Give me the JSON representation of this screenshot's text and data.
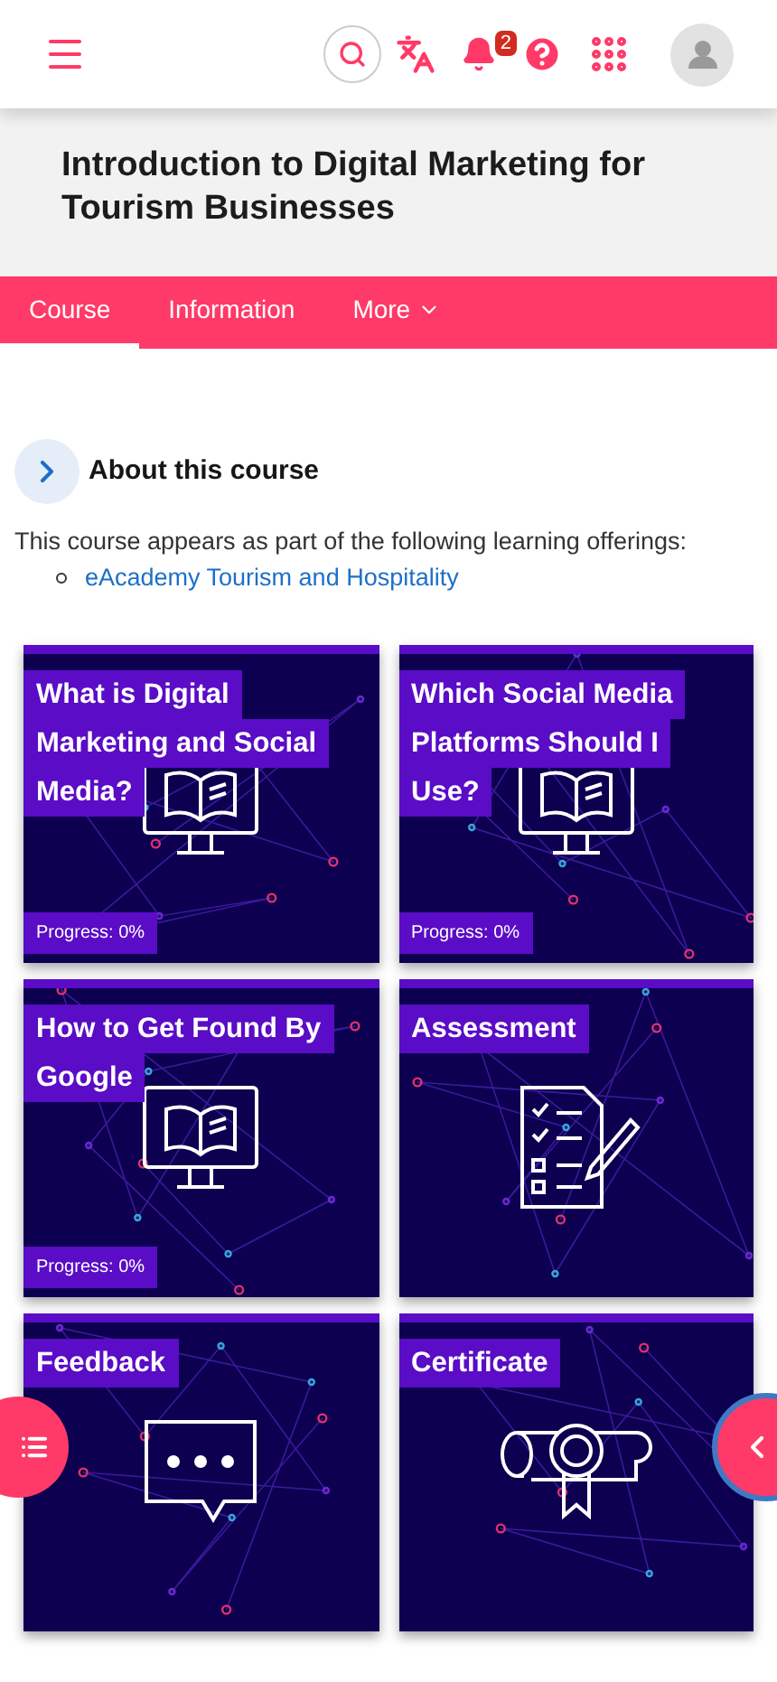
{
  "header": {
    "notification_count": "2"
  },
  "course": {
    "title": "Introduction to Digital Marketing for Tourism Businesses"
  },
  "tabs": [
    {
      "label": "Course",
      "selected": true,
      "dropdown": false
    },
    {
      "label": "Information",
      "selected": false,
      "dropdown": false
    },
    {
      "label": "More",
      "selected": false,
      "dropdown": true
    }
  ],
  "about": {
    "heading": "About this course",
    "expanded": false,
    "intro": "This course appears as part of the following learning offerings:",
    "offerings": [
      "eAcademy Tourism and Hospitality"
    ]
  },
  "activities": [
    {
      "kind": "lesson",
      "title_lines": [
        "What is Digital",
        "Marketing and Social",
        "Media?"
      ],
      "progress": "Progress: 0%"
    },
    {
      "kind": "lesson",
      "title_lines": [
        "Which Social Media",
        "Platforms Should I",
        "Use?"
      ],
      "progress": "Progress: 0%"
    },
    {
      "kind": "lesson",
      "title_lines": [
        "How to Get Found By",
        "Google"
      ],
      "progress": "Progress: 0%"
    },
    {
      "kind": "assessment",
      "title_lines": [
        "Assessment"
      ]
    },
    {
      "kind": "feedback",
      "title_lines": [
        "Feedback"
      ]
    },
    {
      "kind": "certificate",
      "title_lines": [
        "Certificate"
      ]
    }
  ]
}
